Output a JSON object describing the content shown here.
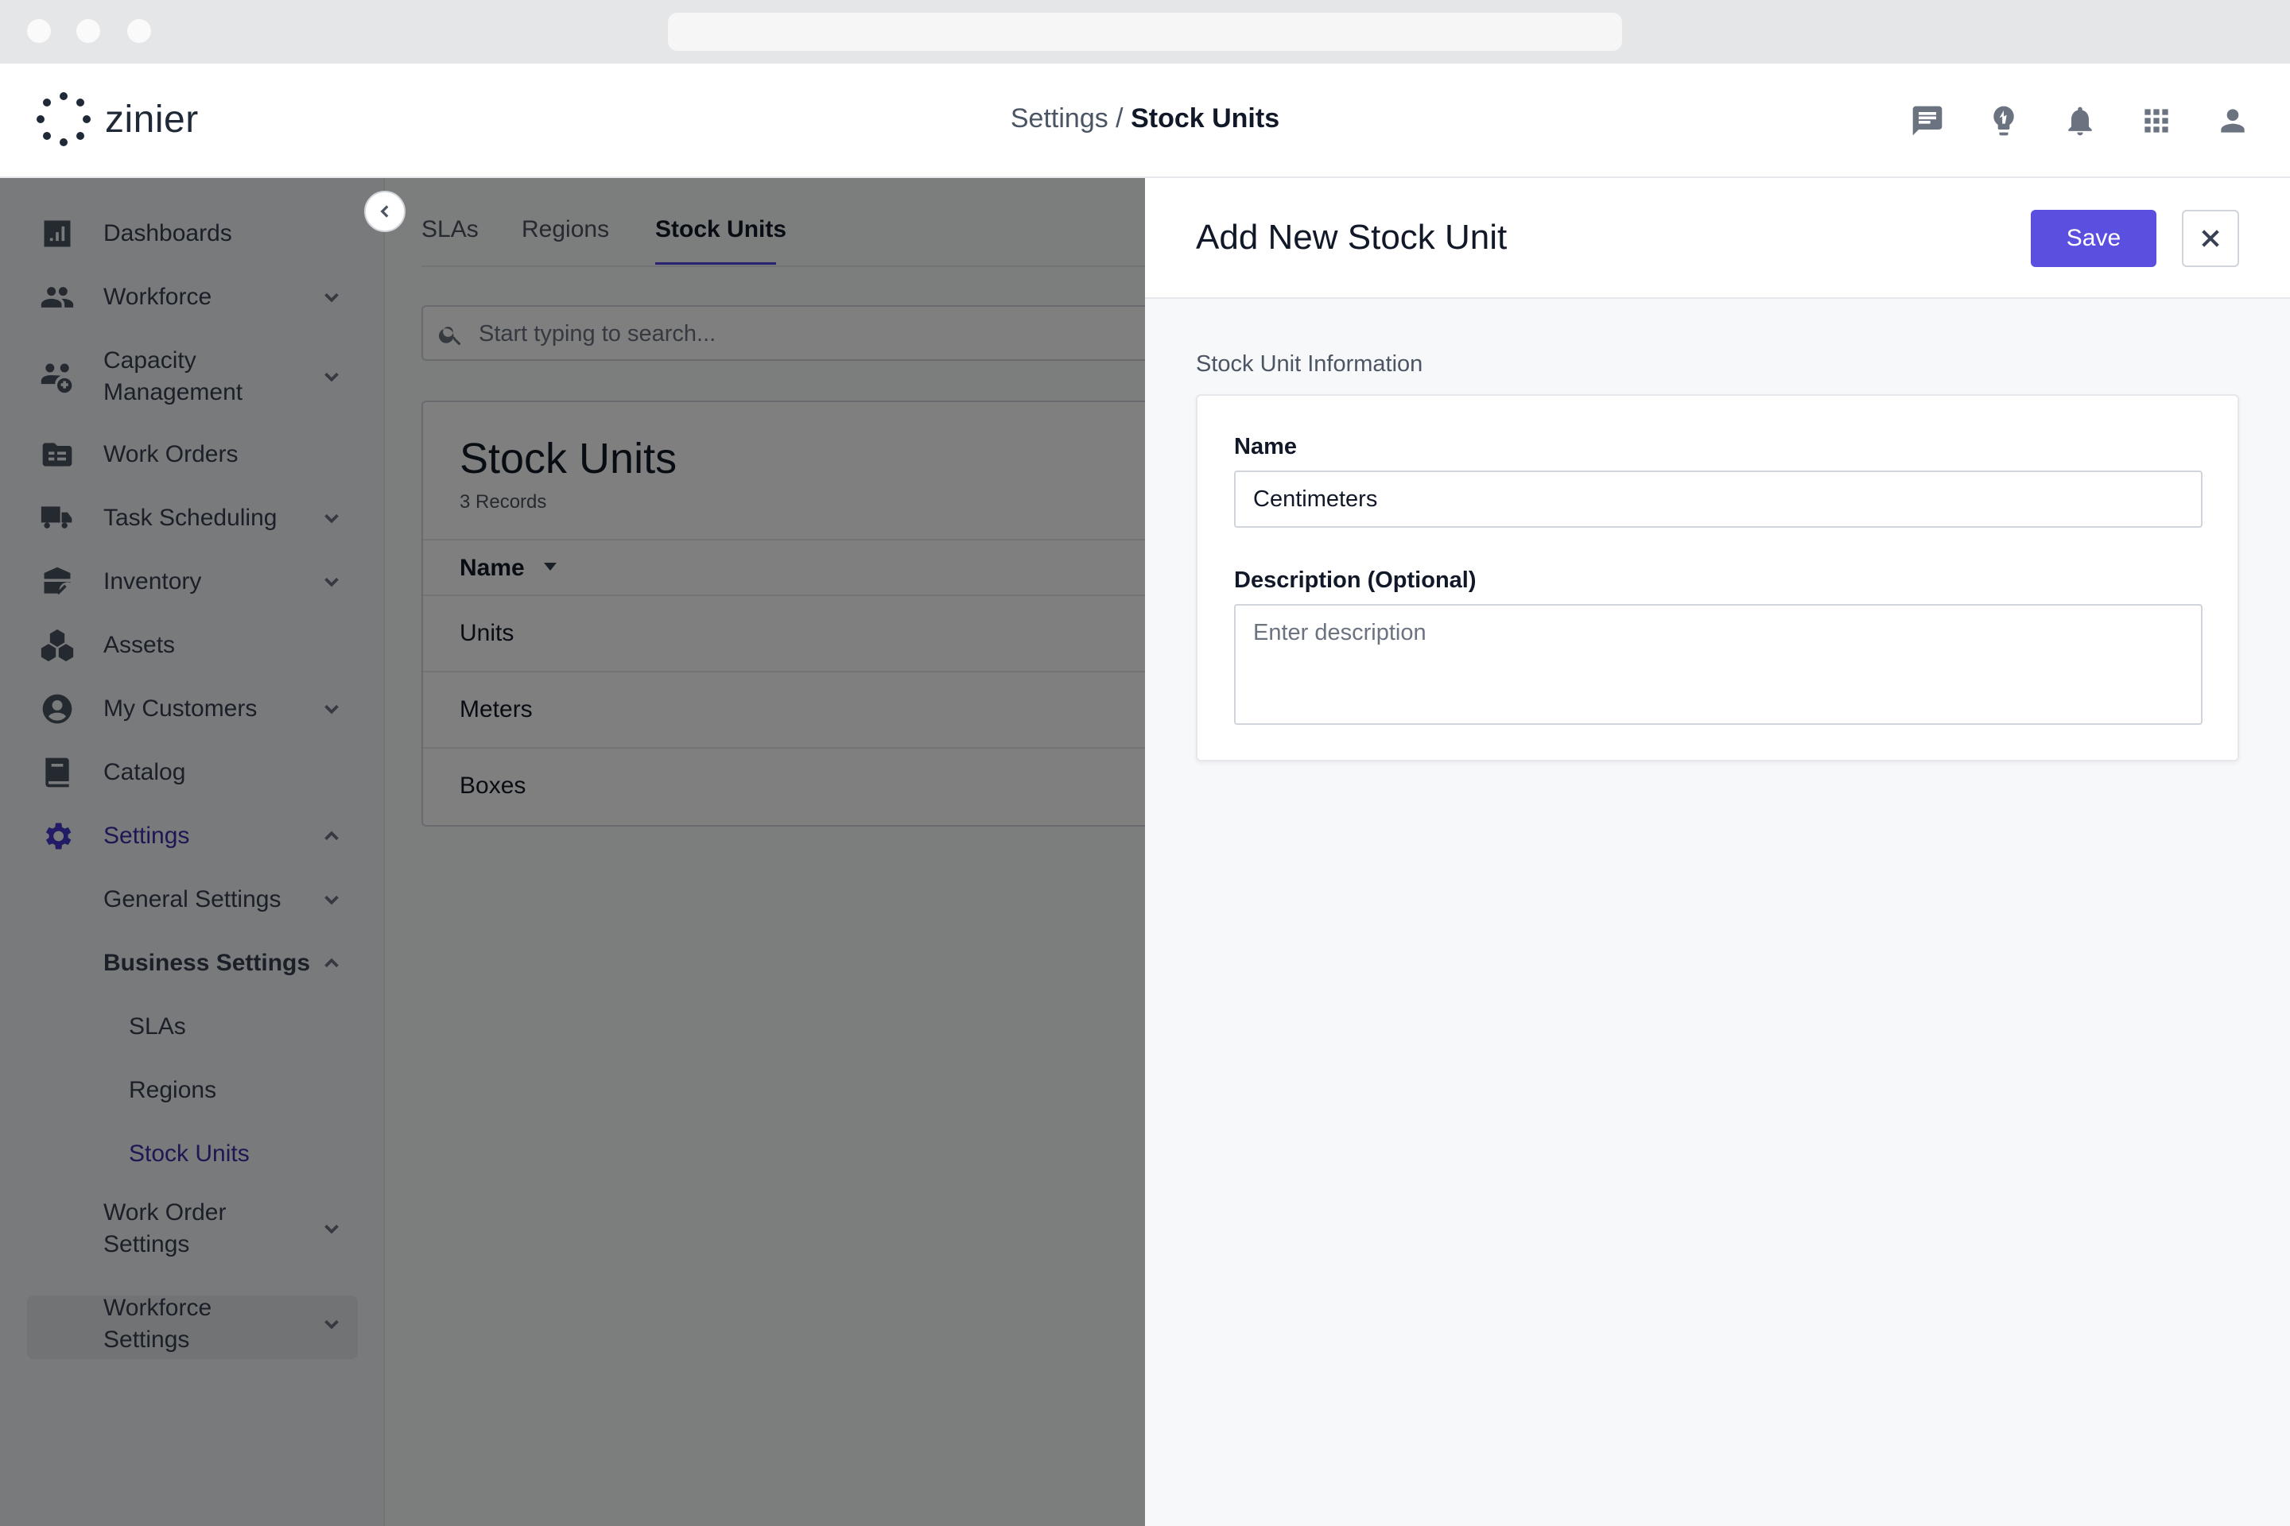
{
  "app": {
    "logo_text": "zinier"
  },
  "breadcrumb": {
    "parent": "Settings",
    "separator": " / ",
    "current": "Stock Units"
  },
  "header_icons": [
    "chat-icon",
    "lightbulb-icon",
    "bell-icon",
    "apps-grid-icon",
    "user-icon"
  ],
  "sidebar": {
    "items": [
      {
        "label": "Dashboards",
        "icon": "dashboard-icon",
        "chevron": false
      },
      {
        "label": "Workforce",
        "icon": "people-icon",
        "chevron": true
      },
      {
        "label": "Capacity\nManagement",
        "icon": "capacity-icon",
        "chevron": true
      },
      {
        "label": "Work Orders",
        "icon": "work-orders-icon",
        "chevron": false
      },
      {
        "label": "Task Scheduling",
        "icon": "truck-icon",
        "chevron": true
      },
      {
        "label": "Inventory",
        "icon": "inventory-icon",
        "chevron": true
      },
      {
        "label": "Assets",
        "icon": "assets-icon",
        "chevron": false
      },
      {
        "label": "My Customers",
        "icon": "customer-icon",
        "chevron": true
      },
      {
        "label": "Catalog",
        "icon": "catalog-icon",
        "chevron": false
      },
      {
        "label": "Settings",
        "icon": "gear-icon",
        "chevron": "up"
      }
    ],
    "sub_items": [
      {
        "label": "General Settings",
        "chevron": "down"
      },
      {
        "label": "Business Settings",
        "chevron": "up"
      },
      {
        "label": "SLAs"
      },
      {
        "label": "Regions"
      },
      {
        "label": "Stock Units"
      },
      {
        "label": "Work Order\nSettings",
        "chevron": "down"
      },
      {
        "label": "Workforce\nSettings",
        "chevron": "down"
      }
    ]
  },
  "main": {
    "tabs": [
      "SLAs",
      "Regions",
      "Stock Units"
    ],
    "active_tab": "Stock Units",
    "search_placeholder": "Start typing to search...",
    "card_title": "Stock Units",
    "record_count": "3 Records",
    "column_header": "Name",
    "rows": [
      "Units",
      "Meters",
      "Boxes"
    ]
  },
  "drawer": {
    "title": "Add New Stock Unit",
    "save_label": "Save",
    "section_label": "Stock Unit Information",
    "name_label": "Name",
    "name_value": "Centimeters",
    "description_label": "Description (Optional)",
    "description_placeholder": "Enter description"
  },
  "colors": {
    "accent": "#5b4fe0",
    "active_nav": "#3b2ea8"
  }
}
